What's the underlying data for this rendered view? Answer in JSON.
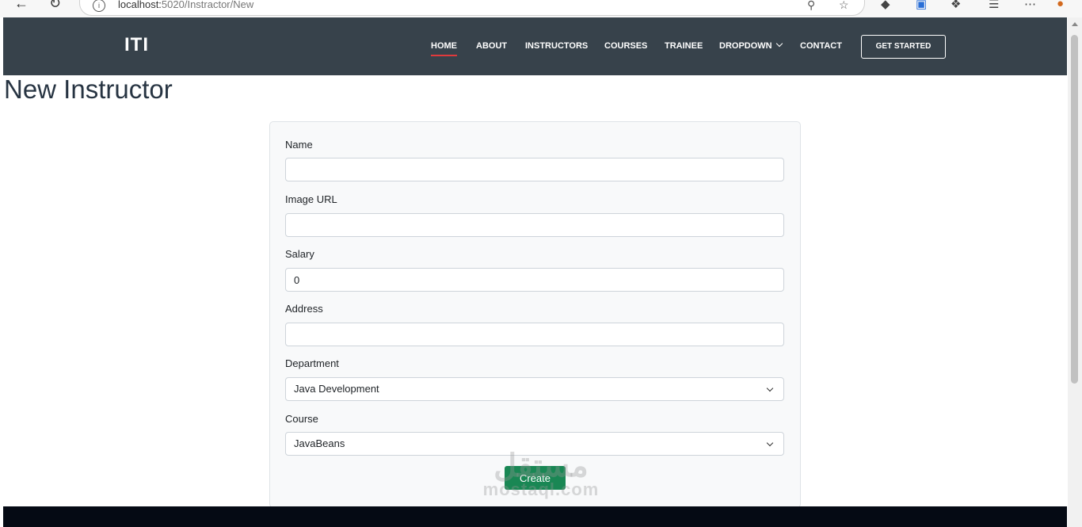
{
  "browser": {
    "url_host": "localhost:",
    "url_path": "5020/Instractor/New"
  },
  "header": {
    "logo": "ITI",
    "nav": [
      {
        "label": "HOME",
        "active": true
      },
      {
        "label": "ABOUT"
      },
      {
        "label": "INSTRUCTORS"
      },
      {
        "label": "COURSES"
      },
      {
        "label": "TRAINEE"
      },
      {
        "label": "DROPDOWN",
        "dropdown": true
      },
      {
        "label": "CONTACT"
      }
    ],
    "cta_label": "GET STARTED"
  },
  "page_title": "New Instructor",
  "form": {
    "name": {
      "label": "Name",
      "value": ""
    },
    "image_url": {
      "label": "Image URL",
      "value": ""
    },
    "salary": {
      "label": "Salary",
      "value": "0"
    },
    "address": {
      "label": "Address",
      "value": ""
    },
    "department": {
      "label": "Department",
      "selected": "Java Development"
    },
    "course": {
      "label": "Course",
      "selected": "JavaBeans"
    },
    "submit_label": "Create"
  },
  "watermark": {
    "arabic": "مستقل",
    "latin": "mostaql.com"
  }
}
